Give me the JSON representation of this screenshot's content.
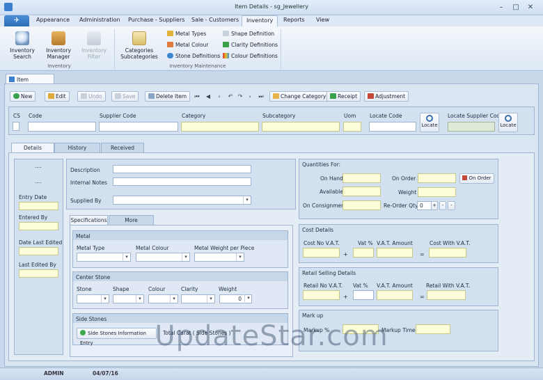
{
  "window": {
    "title": "Item Details - sg_Jewellery"
  },
  "menu": {
    "tabs": [
      "Appearance",
      "Administration",
      "Purchase - Suppliers",
      "Sale - Customers",
      "Inventory",
      "Reports",
      "View"
    ],
    "active": "Inventory"
  },
  "ribbon": {
    "inventory_search": "Inventory Search",
    "inventory_manager": "Inventory Manager",
    "inventory_filter": "Inventory Filter",
    "inventory_group": "Inventory",
    "categories": "Categories Subcategories",
    "metal_types": "Metal Types",
    "metal_colour": "Metal Colour",
    "stone_definitions": "Stone Definitions",
    "shape_definition": "Shape Definition",
    "clarity_definitions": "Clarity Definitions",
    "colour_definitions": "Colour Definitions",
    "maintenance_group": "Inventory Maintenance"
  },
  "doc_tab": "Item Details",
  "toolbar": {
    "new": "New",
    "edit": "Edit",
    "undo": "Undo",
    "save": "Save",
    "delete": "Delete Item",
    "change_category": "Change Category",
    "receipt": "Receipt",
    "adjustment": "Adjustment"
  },
  "header_fields": {
    "cs": "CS",
    "code": "Code",
    "supplier_code": "Supplier Code",
    "category": "Category",
    "subcategory": "Subcategory",
    "uom": "Uom",
    "locate_code": "Locate Code",
    "locate": "Locate",
    "locate_supplier_code": "Locate Supplier Code",
    "locate2": "Locate"
  },
  "detail_tabs": [
    "Details",
    "History",
    "Received"
  ],
  "left_panel": {
    "dots1": "....",
    "dots2": "....",
    "entry_date": "Entry Date",
    "entered_by": "Entered By",
    "date_last_edited": "Date Last Edited",
    "last_edited_by": "Last Edited By"
  },
  "desc_panel": {
    "description": "Description",
    "internal_notes": "Internal Notes",
    "supplied_by": "Supplied By"
  },
  "spec_tabs": [
    "Specifications",
    "More Information"
  ],
  "metal": {
    "header": "Metal",
    "metal_type": "Metal Type",
    "metal_colour": "Metal Colour",
    "metal_weight": "Metal Weight per Piece"
  },
  "center_stone": {
    "header": "Center Stone",
    "stone": "Stone",
    "shape": "Shape",
    "colour": "Colour",
    "clarity": "Clarity",
    "weight": "Weight",
    "weight_value": "0"
  },
  "side_stones": {
    "header": "Side Stones",
    "button": "Side Stones Information Entry",
    "total_carat": "Total Carat ( Side Stones )"
  },
  "quantities": {
    "header": "Quantities For:",
    "on_hand": "On Hand",
    "available": "Available",
    "on_consignment": "On Consignment",
    "on_order": "On Order",
    "weight": "Weight",
    "reorder_qty": "Re-Order Qty",
    "reorder_value": "0",
    "on_order_btn": "On Order"
  },
  "cost": {
    "header": "Cost Details",
    "cost_no_vat": "Cost No V.A.T.",
    "vat_pct": "Vat %",
    "vat_amount": "V.A.T. Amount",
    "cost_with_vat": "Cost With V.A.T.",
    "plus": "+",
    "equals": "="
  },
  "retail": {
    "header": "Retail Selling Details",
    "retail_no_vat": "Retail No V.A.T.",
    "vat_pct": "Vat %",
    "vat_amount": "V.A.T. Amount",
    "retail_with_vat": "Retail With V.A.T.",
    "plus": "+",
    "equals": "="
  },
  "markup": {
    "header": "Mark up",
    "markup_pct": "Markup %",
    "markup_times": "Markup Times"
  },
  "status": {
    "user": "ADMIN",
    "date": "04/07/16"
  },
  "watermark": "UpdateStar.com"
}
